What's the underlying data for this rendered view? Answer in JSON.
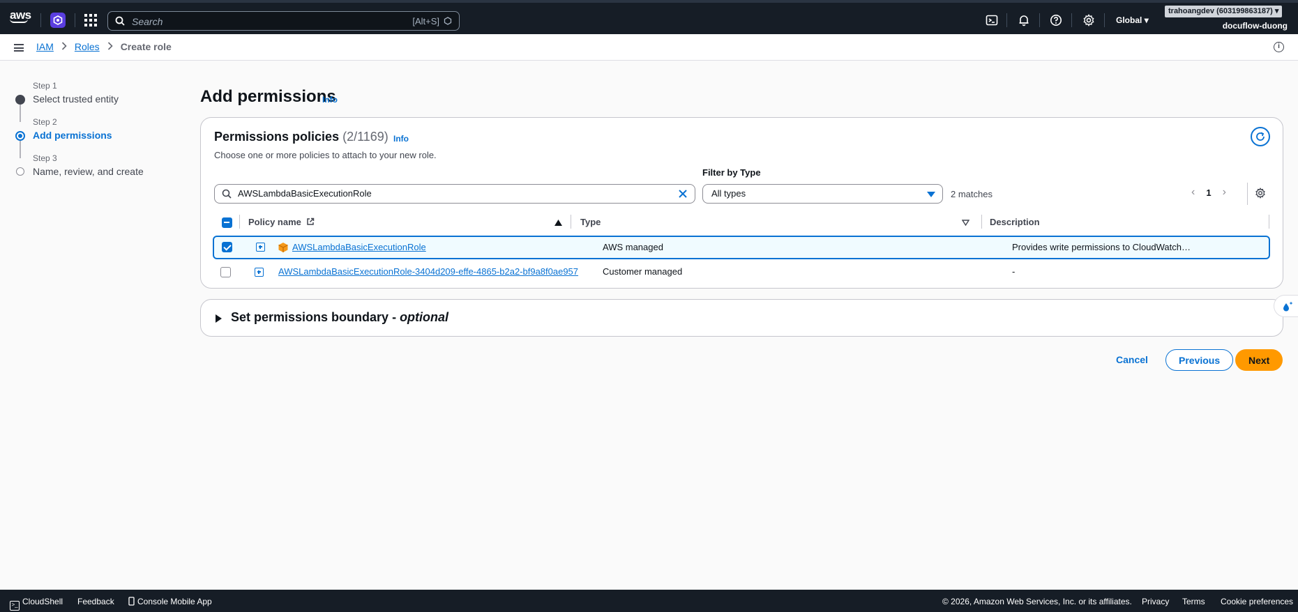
{
  "topnav": {
    "logo_text": "aws",
    "search_placeholder": "Search",
    "search_shortcut": "[Alt+S]",
    "region": "Global",
    "account": "trahoangdev (603199863187)",
    "user": "docuflow-duong",
    "icons": [
      "cloudshell-icon",
      "bell-icon",
      "help-icon",
      "settings-icon"
    ]
  },
  "breadcrumb": {
    "items": [
      "IAM",
      "Roles"
    ],
    "current": "Create role"
  },
  "steps": [
    {
      "num": "Step 1",
      "label": "Select trusted entity",
      "state": "done"
    },
    {
      "num": "Step 2",
      "label": "Add permissions",
      "state": "active"
    },
    {
      "num": "Step 3",
      "label": "Name, review, and create",
      "state": "todo"
    }
  ],
  "page": {
    "title": "Add permissions",
    "info": "Info"
  },
  "policies": {
    "title": "Permissions policies",
    "count": "(2/1169)",
    "info": "Info",
    "description": "Choose one or more policies to attach to your new role.",
    "search_value": "AWSLambdaBasicExecutionRole",
    "filter_label": "Filter by Type",
    "filter_value": "All types",
    "matches": "2 matches",
    "page": "1",
    "columns": [
      "Policy name",
      "Type",
      "Description"
    ],
    "rows": [
      {
        "name": "AWSLambdaBasicExecutionRole",
        "type": "AWS managed",
        "description": "Provides write permissions to CloudWatch…",
        "selected": true
      },
      {
        "name": "AWSLambdaBasicExecutionRole-3404d209-effe-4865-b2a2-bf9a8f0ae957",
        "type": "Customer managed",
        "description": "-",
        "selected": false
      }
    ]
  },
  "boundary": {
    "title": "Set permissions boundary",
    "optional": "optional"
  },
  "actions": {
    "cancel": "Cancel",
    "previous": "Previous",
    "next": "Next"
  },
  "footer": {
    "cloudshell": "CloudShell",
    "feedback": "Feedback",
    "mobile": "Console Mobile App",
    "copyright": "© 2026, Amazon Web Services, Inc. or its affiliates.",
    "privacy": "Privacy",
    "terms": "Terms",
    "cookies": "Cookie preferences"
  },
  "colors": {
    "accent": "#0972d3",
    "nav_bg": "#161d26",
    "primary_button": "#ff9900"
  }
}
